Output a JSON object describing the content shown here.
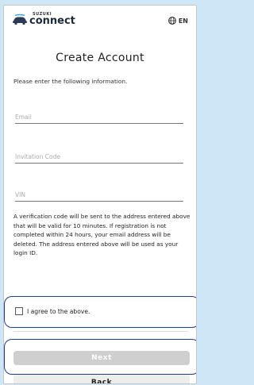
{
  "header": {
    "brand_small": "SUZUKI",
    "brand_main": "connect",
    "lang_label": "EN"
  },
  "title": "Create Account",
  "instruction": "Please enter the following information.",
  "fields": {
    "email_placeholder": "Email",
    "invitation_placeholder": "Invitation Code",
    "vin_placeholder": "VIN"
  },
  "notice": "A verification code will be sent to the address entered above that will be valid for 10 minutes. If registration is not completed within 24 hours, your email address will be deleted. The address entered above will be used as your login ID.",
  "agree_label": "I agree to the above.",
  "buttons": {
    "next": "Next",
    "back": "Back"
  },
  "colors": {
    "highlight": "#1e3f8f",
    "disabled_button": "#cfcfcf"
  }
}
